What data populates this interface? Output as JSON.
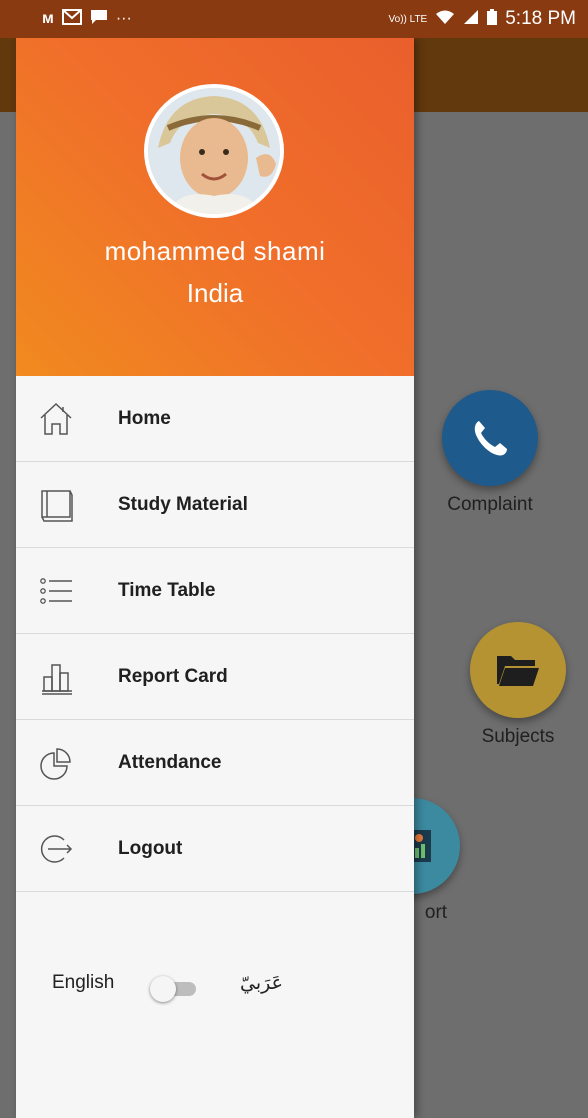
{
  "status_bar": {
    "left_icons": [
      "m-icon",
      "mail-icon",
      "message-icon",
      "more-icon"
    ],
    "more_text": "···",
    "volte": "Vo)) LTE",
    "time": "5:18 PM"
  },
  "background_app": {
    "tiles": [
      {
        "label": "Complaint",
        "icon": "phone-icon",
        "color": "#1f5a8c"
      },
      {
        "label": "Subjects",
        "icon": "folder-icon",
        "color": "#b59332"
      },
      {
        "label": "ort",
        "icon": "report-icon",
        "color": "#3b8aa0"
      }
    ]
  },
  "drawer": {
    "user": {
      "name": "mohammed shami",
      "country": "India"
    },
    "menu": [
      {
        "label": "Home",
        "icon": "home-icon"
      },
      {
        "label": "Study Material",
        "icon": "book-icon"
      },
      {
        "label": "Time Table",
        "icon": "list-icon"
      },
      {
        "label": "Report Card",
        "icon": "bar-chart-icon"
      },
      {
        "label": "Attendance",
        "icon": "pie-chart-icon"
      },
      {
        "label": "Logout",
        "icon": "logout-icon"
      }
    ],
    "language": {
      "english": "English",
      "arabic": "عَرَبيّ",
      "toggle_on": false
    }
  },
  "colors": {
    "header_start": "#f18a1f",
    "header_end": "#ea5f2c",
    "status_bar": "#8a3a10",
    "toolbar": "#62380d"
  }
}
